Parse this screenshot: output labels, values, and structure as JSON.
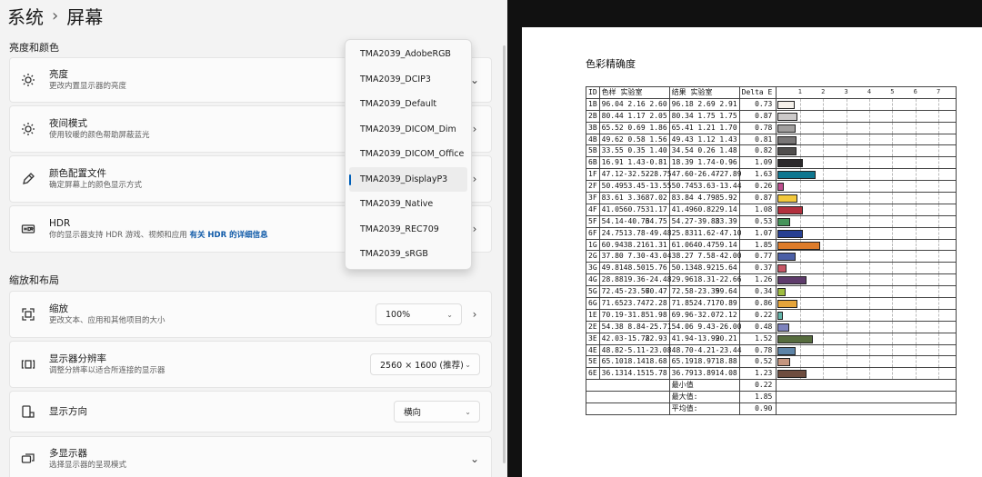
{
  "breadcrumb": {
    "parent": "系统",
    "separator": "›",
    "current": "屏幕"
  },
  "sections": {
    "brightness_color": "亮度和颜色",
    "scale_layout": "缩放和布局"
  },
  "cards": {
    "brightness": {
      "title": "亮度",
      "desc": "更改内置显示器的亮度",
      "icon": "sun-icon"
    },
    "night_light": {
      "title": "夜间模式",
      "desc": "使用较暖的颜色帮助屏蔽蓝光",
      "icon": "night-sun-icon"
    },
    "color_profile": {
      "title": "颜色配置文件",
      "desc": "确定屏幕上的颜色显示方式",
      "icon": "pen-icon"
    },
    "hdr": {
      "title": "HDR",
      "desc": "你的显示器支持 HDR 游戏、视频和应用",
      "link": "有关 HDR 的详细信息",
      "icon": "hdr-icon"
    },
    "scale": {
      "title": "缩放",
      "desc": "更改文本、应用和其他项目的大小",
      "value": "100%",
      "icon": "scale-icon"
    },
    "resolution": {
      "title": "显示器分辨率",
      "desc": "调整分辨率以适合所连接的显示器",
      "value": "2560 × 1600 (推荐)",
      "icon": "resolution-icon"
    },
    "orientation": {
      "title": "显示方向",
      "value": "横向",
      "icon": "orientation-icon"
    },
    "multi_display": {
      "title": "多显示器",
      "desc": "选择显示器的呈现模式",
      "icon": "multi-display-icon"
    }
  },
  "profile_menu": {
    "items": [
      "TMA2039_AdobeRGB",
      "TMA2039_DCIP3",
      "TMA2039_Default",
      "TMA2039_DICOM_Dim",
      "TMA2039_DICOM_Office",
      "TMA2039_DisplayP3",
      "TMA2039_Native",
      "TMA2039_REC709",
      "TMA2039_sRGB"
    ],
    "selected_index": 5,
    "accent": "#005fb8"
  },
  "document": {
    "title": "色彩精确度",
    "headers": {
      "id": "ID",
      "target": "色样 实验室",
      "result": "结果 实验室",
      "delta": "Delta E"
    },
    "scale_ticks": [
      "1",
      "2",
      "3",
      "4",
      "5",
      "6",
      "7"
    ],
    "rows": [
      {
        "id": "1B",
        "t": [
          "96.04",
          "2.16",
          "2.60"
        ],
        "r": [
          "96.18",
          "2.69",
          "2.91"
        ],
        "de": "0.73",
        "color": "#f4f0ea"
      },
      {
        "id": "2B",
        "t": [
          "80.44",
          "1.17",
          "2.05"
        ],
        "r": [
          "80.34",
          "1.75",
          "1.75"
        ],
        "de": "0.87",
        "color": "#cccaca"
      },
      {
        "id": "3B",
        "t": [
          "65.52",
          "0.69",
          "1.86"
        ],
        "r": [
          "65.41",
          "1.21",
          "1.70"
        ],
        "de": "0.78",
        "color": "#a19f9e"
      },
      {
        "id": "4B",
        "t": [
          "49.62",
          "0.58",
          "1.56"
        ],
        "r": [
          "49.43",
          "1.12",
          "1.43"
        ],
        "de": "0.81",
        "color": "#787676"
      },
      {
        "id": "5B",
        "t": [
          "33.55",
          "0.35",
          "1.40"
        ],
        "r": [
          "34.54",
          "0.26",
          "1.48"
        ],
        "de": "0.82",
        "color": "#504e4d"
      },
      {
        "id": "6B",
        "t": [
          "16.91",
          "1.43",
          "-0.81"
        ],
        "r": [
          "18.39",
          "1.74",
          "-0.96"
        ],
        "de": "1.09",
        "color": "#2b292b"
      },
      {
        "id": "1F",
        "t": [
          "47.12",
          "-32.52",
          "-28.75"
        ],
        "r": [
          "47.60",
          "-26.47",
          "-27.89"
        ],
        "de": "1.63",
        "color": "#0f7790"
      },
      {
        "id": "2F",
        "t": [
          "50.49",
          "53.45",
          "-13.55"
        ],
        "r": [
          "50.74",
          "53.63",
          "-13.44"
        ],
        "de": "0.26",
        "color": "#bd4d8e"
      },
      {
        "id": "3F",
        "t": [
          "83.61",
          "3.36",
          "87.02"
        ],
        "r": [
          "83.84",
          "4.79",
          "85.92"
        ],
        "de": "0.87",
        "color": "#f2c83c"
      },
      {
        "id": "4F",
        "t": [
          "41.05",
          "60.75",
          "31.17"
        ],
        "r": [
          "41.49",
          "60.82",
          "29.14"
        ],
        "de": "1.08",
        "color": "#b22f3d"
      },
      {
        "id": "5F",
        "t": [
          "54.14",
          "-40.76",
          "34.75"
        ],
        "r": [
          "54.27",
          "-39.88",
          "33.39"
        ],
        "de": "0.53",
        "color": "#46945a"
      },
      {
        "id": "6F",
        "t": [
          "24.75",
          "13.78",
          "-49.48"
        ],
        "r": [
          "25.83",
          "11.62",
          "-47.10"
        ],
        "de": "1.07",
        "color": "#273f92"
      },
      {
        "id": "1G",
        "t": [
          "60.94",
          "38.21",
          "61.31"
        ],
        "r": [
          "61.06",
          "40.47",
          "59.14"
        ],
        "de": "1.85",
        "color": "#dd7c2b"
      },
      {
        "id": "2G",
        "t": [
          "37.80",
          "7.30",
          "-43.04"
        ],
        "r": [
          "38.27",
          "7.58",
          "-42.00"
        ],
        "de": "0.77",
        "color": "#4b5fa6"
      },
      {
        "id": "3G",
        "t": [
          "49.81",
          "48.50",
          "15.76"
        ],
        "r": [
          "50.13",
          "48.92",
          "15.64"
        ],
        "de": "0.37",
        "color": "#c75665"
      },
      {
        "id": "4G",
        "t": [
          "28.88",
          "19.36",
          "-24.48"
        ],
        "r": [
          "29.96",
          "18.31",
          "-22.66"
        ],
        "de": "1.26",
        "color": "#5e3b6b"
      },
      {
        "id": "5G",
        "t": [
          "72.45",
          "-23.57",
          "60.47"
        ],
        "r": [
          "72.58",
          "-23.39",
          "59.64"
        ],
        "de": "0.34",
        "color": "#9ebc3f"
      },
      {
        "id": "6G",
        "t": [
          "71.65",
          "23.74",
          "72.28"
        ],
        "r": [
          "71.85",
          "24.71",
          "70.89"
        ],
        "de": "0.86",
        "color": "#e5a43a"
      },
      {
        "id": "1E",
        "t": [
          "70.19",
          "-31.85",
          "1.98"
        ],
        "r": [
          "69.96",
          "-32.07",
          "2.12"
        ],
        "de": "0.22",
        "color": "#62b3a9"
      },
      {
        "id": "2E",
        "t": [
          "54.38",
          "8.84",
          "-25.71"
        ],
        "r": [
          "54.06",
          "9.43",
          "-26.00"
        ],
        "de": "0.48",
        "color": "#7d82bd"
      },
      {
        "id": "3E",
        "t": [
          "42.03",
          "-15.78",
          "22.93"
        ],
        "r": [
          "41.94",
          "-13.99",
          "20.21"
        ],
        "de": "1.52",
        "color": "#566c3e"
      },
      {
        "id": "4E",
        "t": [
          "48.82",
          "-5.11",
          "-23.08"
        ],
        "r": [
          "48.70",
          "-4.21",
          "-23.44"
        ],
        "de": "0.78",
        "color": "#5d84a7"
      },
      {
        "id": "5E",
        "t": [
          "65.10",
          "18.14",
          "18.68"
        ],
        "r": [
          "65.19",
          "18.97",
          "18.88"
        ],
        "de": "0.52",
        "color": "#c5967f"
      },
      {
        "id": "6E",
        "t": [
          "36.13",
          "14.15",
          "15.78"
        ],
        "r": [
          "36.79",
          "13.89",
          "14.08"
        ],
        "de": "1.23",
        "color": "#6e4d3f"
      }
    ],
    "stats": [
      {
        "label": "最小值",
        "value": "0.22"
      },
      {
        "label": "最大值:",
        "value": "1.85"
      },
      {
        "label": "平均值:",
        "value": "0.90"
      }
    ]
  }
}
